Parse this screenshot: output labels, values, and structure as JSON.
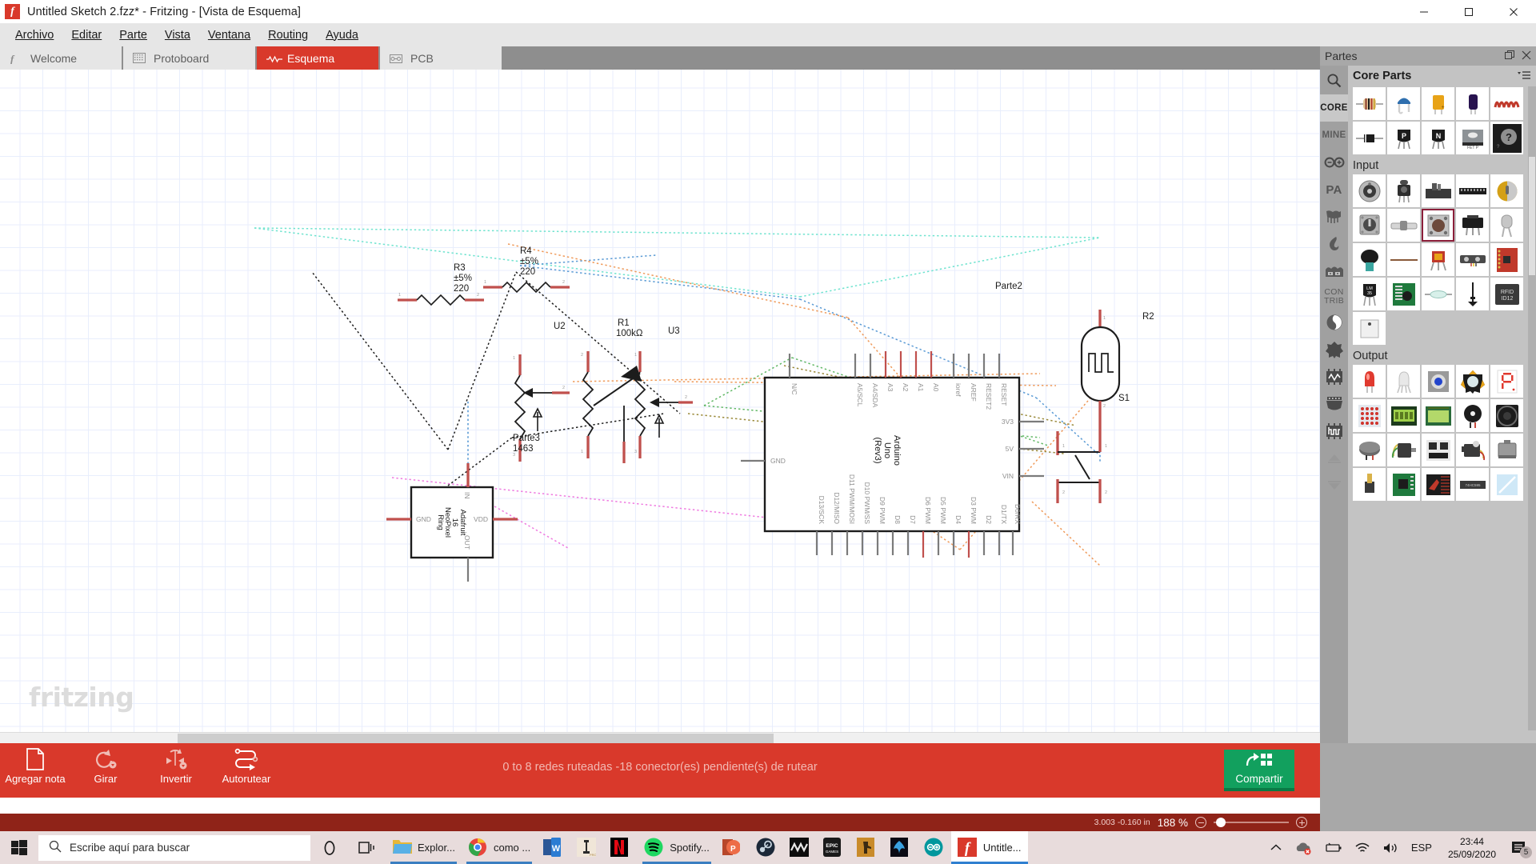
{
  "window": {
    "title": "Untitled Sketch 2.fzz* - Fritzing - [Vista de Esquema]",
    "logo": "fritzing-logo-icon",
    "minimize": "—",
    "maximize": "▢",
    "close": "✕"
  },
  "menu": {
    "items": [
      {
        "label": "Archivo",
        "accel": "A"
      },
      {
        "label": "Editar",
        "accel": "E"
      },
      {
        "label": "Parte",
        "accel": "P"
      },
      {
        "label": "Vista",
        "accel": "V"
      },
      {
        "label": "Ventana",
        "accel": "V"
      },
      {
        "label": "Routing",
        "accel": "R"
      },
      {
        "label": "Ayuda",
        "accel": "A"
      }
    ]
  },
  "tabs": [
    {
      "label": "Welcome",
      "icon": "fritzing-f-icon",
      "active": false
    },
    {
      "label": "Protoboard",
      "icon": "breadboard-icon",
      "active": false
    },
    {
      "label": "Esquema",
      "icon": "schematic-resistor-icon",
      "active": true
    },
    {
      "label": "PCB",
      "icon": "pcb-icon",
      "active": false
    }
  ],
  "canvas": {
    "watermark": "fritzing",
    "parts": [
      {
        "ref": "R3",
        "line2": "±5%",
        "line3": "220",
        "type": "resistor"
      },
      {
        "ref": "R4",
        "line2": "±5%",
        "line3": "220",
        "type": "resistor"
      },
      {
        "ref": "R1",
        "line2": "100kΩ",
        "type": "resistor"
      },
      {
        "ref": "U2",
        "type": "trimmer-potentiometer"
      },
      {
        "ref": "U3",
        "type": "trimmer-potentiometer"
      },
      {
        "ref": "Parte3",
        "line2": "1463",
        "type": "potentiometer"
      },
      {
        "ref": "Parte2",
        "type": "photoresistor-group"
      },
      {
        "ref": "R2",
        "type": "photoresistor"
      },
      {
        "ref": "S1",
        "type": "pushbutton-switch"
      }
    ],
    "arduino": {
      "name_line1": "Arduino",
      "name_line2": "Uno",
      "name_line3": "(Rev3)",
      "top_pins": [
        "N/C",
        "A5/SCL",
        "A4/SDA",
        "A3",
        "A2",
        "A1",
        "A0",
        "ioref",
        "AREF",
        "RESET2",
        "RESET"
      ],
      "bottom_pins": [
        "D13/SCK",
        "D12/MISO",
        "D11 PWM/MOSI",
        "D10 PWM/SS",
        "D9 PWM",
        "D8",
        "D7",
        "D6 PWM",
        "D5 PWM",
        "D4",
        "D3 PWM",
        "D2",
        "D1/TX",
        "D0/RX"
      ],
      "left_pins": [
        "GND"
      ],
      "right_pins": [
        "3V3",
        "5V",
        "VIN"
      ]
    },
    "neopixel": {
      "name_line1": "Adafruit",
      "name_line2": "16",
      "name_line3": "NeoPixel",
      "name_line4": "Ring",
      "pins": [
        "GND",
        "IN",
        "VDD",
        "OUT"
      ]
    }
  },
  "parts_panel": {
    "title": "Partes",
    "dock_icon": "undock-icon",
    "close_icon": "close-icon",
    "search_icon": "search-icon",
    "bin_title": "Core Parts",
    "bin_menu_icon": "bin-menu-icon",
    "side_tabs": [
      {
        "label": "CORE",
        "type": "text",
        "active": true
      },
      {
        "label": "MINE",
        "type": "text",
        "active": false
      },
      {
        "label": "arduino-icon",
        "type": "icon",
        "active": false
      },
      {
        "label": "PA",
        "type": "text",
        "active": false
      },
      {
        "label": "parallax-icon",
        "type": "icon",
        "active": false
      },
      {
        "label": "sparkfun-icon",
        "type": "icon",
        "active": false
      },
      {
        "label": "snootlab-icon",
        "type": "icon",
        "active": false
      },
      {
        "label": "CON TRIB",
        "type": "text",
        "active": false
      },
      {
        "label": "moon-icon",
        "type": "icon",
        "active": false
      },
      {
        "label": "flower-icon",
        "type": "icon",
        "active": false
      },
      {
        "label": "ic-wave-icon",
        "type": "icon",
        "active": false
      },
      {
        "label": "connector-icon",
        "type": "icon",
        "active": false
      },
      {
        "label": "ic-square-icon",
        "type": "icon",
        "active": false
      }
    ],
    "scroll_up_icon": "scroll-up-icon",
    "scroll_down_icon": "scroll-down-icon",
    "sections": [
      {
        "label": "",
        "items": [
          {
            "name": "resistor-part"
          },
          {
            "name": "ceramic-capacitor-part"
          },
          {
            "name": "electrolytic-capacitor-part"
          },
          {
            "name": "capacitor-part"
          },
          {
            "name": "inductor-part"
          },
          {
            "name": "diode-part"
          },
          {
            "name": "pnp-transistor-part"
          },
          {
            "name": "npn-transistor-part"
          },
          {
            "name": "mosfet-part"
          },
          {
            "name": "mystery-part"
          }
        ]
      },
      {
        "label": "Input",
        "items": [
          {
            "name": "rotary-potentiometer-part"
          },
          {
            "name": "trimmer-potentiometer-part"
          },
          {
            "name": "slide-potentiometer-part"
          },
          {
            "name": "dip-switch-part"
          },
          {
            "name": "rotary-encoder-part"
          },
          {
            "name": "rotary-switch-part"
          },
          {
            "name": "slide-switch-part"
          },
          {
            "name": "pushbutton-part",
            "selected": true
          },
          {
            "name": "toggle-switch-part"
          },
          {
            "name": "tilt-sensor-part"
          },
          {
            "name": "microphone-part"
          },
          {
            "name": "photoresistor-part"
          },
          {
            "name": "light-sensor-part"
          },
          {
            "name": "distance-sensor-part"
          },
          {
            "name": "accelerometer-breakout-part"
          },
          {
            "name": "lm35-temperature-part"
          },
          {
            "name": "sensor-board-part"
          },
          {
            "name": "reed-switch-part"
          },
          {
            "name": "antenna-part"
          },
          {
            "name": "rfid-id12-part"
          },
          {
            "name": "keypad-part"
          }
        ]
      },
      {
        "label": "Output",
        "items": [
          {
            "name": "red-led-part"
          },
          {
            "name": "white-led-part"
          },
          {
            "name": "blue-led-part"
          },
          {
            "name": "led-star-part"
          },
          {
            "name": "seven-segment-display-part"
          },
          {
            "name": "led-matrix-part"
          },
          {
            "name": "lcd-character-part"
          },
          {
            "name": "lcd-graphic-part"
          },
          {
            "name": "piezo-buzzer-part"
          },
          {
            "name": "speaker-part"
          },
          {
            "name": "vibration-motor-part"
          },
          {
            "name": "dc-motor-part"
          },
          {
            "name": "motor-driver-part"
          },
          {
            "name": "servo-motor-part"
          },
          {
            "name": "stepper-motor-part"
          },
          {
            "name": "solenoid-part"
          },
          {
            "name": "driver-board-part"
          },
          {
            "name": "relay-board-part"
          },
          {
            "name": "shift-register-part"
          },
          {
            "name": "electroluminescent-part"
          }
        ]
      }
    ]
  },
  "bottom_toolbar": {
    "tools": [
      {
        "label": "Agregar nota",
        "icon": "note-icon"
      },
      {
        "label": "Girar",
        "icon": "rotate-icon",
        "has_dropdown": true
      },
      {
        "label": "Invertir",
        "icon": "flip-icon",
        "has_dropdown": true
      },
      {
        "label": "Autorutear",
        "icon": "autoroute-icon"
      }
    ],
    "status": "0 to 8 redes ruteadas -18 conector(es) pendiente(s) de rutear",
    "share_label": "Compartir",
    "share_icon": "share-icon",
    "share_color": "#12a05e"
  },
  "zoom_bar": {
    "coordinates": "3.003 -0.160 in",
    "zoom_value": "188",
    "zoom_unit": "%",
    "minus_icon": "zoom-out-icon",
    "plus_icon": "zoom-in-icon"
  },
  "taskbar": {
    "start_icon": "windows-start-icon",
    "search_placeholder": "Escribe aquí para buscar",
    "search_icon": "search-icon",
    "cortana_icon": "cortana-icon",
    "taskview_icon": "task-view-icon",
    "apps": [
      {
        "label": "Explor...",
        "icon": "file-explorer-icon",
        "running": true
      },
      {
        "label": "como ...",
        "icon": "chrome-icon",
        "running": true
      },
      {
        "label": "",
        "icon": "word-icon",
        "running": false
      },
      {
        "label": "",
        "icon": "pro-tools-icon",
        "running": false
      },
      {
        "label": "",
        "icon": "netflix-icon",
        "running": false
      },
      {
        "label": "Spotify...",
        "icon": "spotify-icon",
        "running": true
      },
      {
        "label": "",
        "icon": "powerpoint-icon",
        "running": false
      },
      {
        "label": "",
        "icon": "steam-icon",
        "running": false
      },
      {
        "label": "",
        "icon": "modern-warfare-icon",
        "running": false
      },
      {
        "label": "",
        "icon": "epic-games-icon",
        "running": false
      },
      {
        "label": "",
        "icon": "csgo-icon",
        "running": false
      },
      {
        "label": "",
        "icon": "battlenet-icon",
        "running": false
      },
      {
        "label": "",
        "icon": "arduino-icon",
        "running": false
      },
      {
        "label": "Untitle...",
        "icon": "fritzing-icon",
        "running": true,
        "active": true
      }
    ],
    "tray": {
      "chevron_icon": "show-hidden-icons",
      "onedrive_icon": "onedrive-error-icon",
      "battery_icon": "battery-icon",
      "wifi_icon": "wifi-icon",
      "volume_icon": "volume-icon",
      "language": "ESP",
      "time": "23:44",
      "date": "25/09/2020",
      "notification_icon": "action-center-icon",
      "notification_count": "5"
    }
  }
}
